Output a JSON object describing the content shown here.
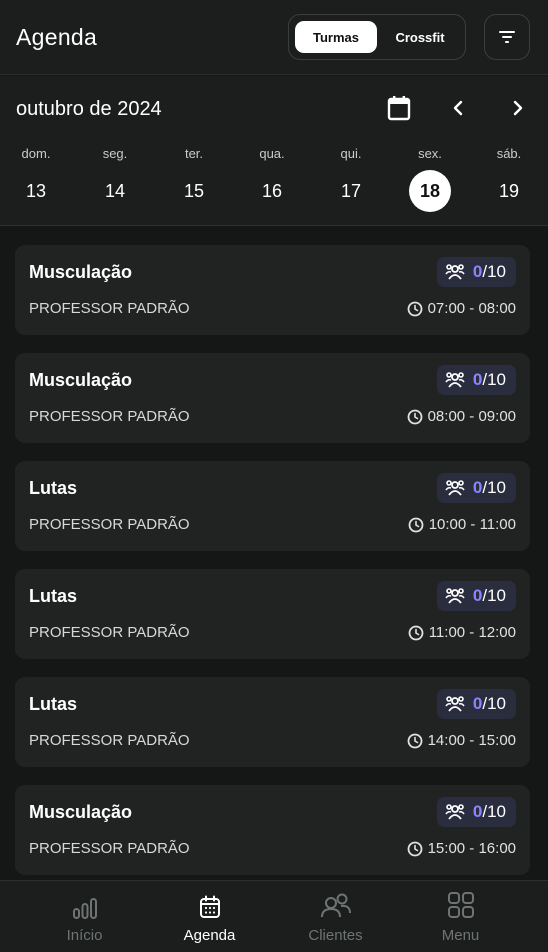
{
  "header": {
    "title": "Agenda",
    "segments": [
      {
        "label": "Turmas",
        "active": true
      },
      {
        "label": "Crossfit",
        "active": false
      }
    ],
    "filter_icon": "filter-icon"
  },
  "calendar": {
    "month_label": "outubro de 2024",
    "icons": {
      "picker": "calendar-icon",
      "prev": "chevron-left-icon",
      "next": "chevron-right-icon"
    },
    "days": [
      {
        "name": "dom.",
        "num": "13",
        "selected": false
      },
      {
        "name": "seg.",
        "num": "14",
        "selected": false
      },
      {
        "name": "ter.",
        "num": "15",
        "selected": false
      },
      {
        "name": "qua.",
        "num": "16",
        "selected": false
      },
      {
        "name": "qui.",
        "num": "17",
        "selected": false
      },
      {
        "name": "sex.",
        "num": "18",
        "selected": true
      },
      {
        "name": "sáb.",
        "num": "19",
        "selected": false
      }
    ]
  },
  "classes": [
    {
      "title": "Musculação",
      "teacher": "PROFESSOR PADRÃO",
      "enrolled": "0",
      "capacity": "/10",
      "time": "07:00 - 08:00"
    },
    {
      "title": "Musculação",
      "teacher": "PROFESSOR PADRÃO",
      "enrolled": "0",
      "capacity": "/10",
      "time": "08:00 - 09:00"
    },
    {
      "title": "Lutas",
      "teacher": "PROFESSOR PADRÃO",
      "enrolled": "0",
      "capacity": "/10",
      "time": "10:00 - 11:00"
    },
    {
      "title": "Lutas",
      "teacher": "PROFESSOR PADRÃO",
      "enrolled": "0",
      "capacity": "/10",
      "time": "11:00 - 12:00"
    },
    {
      "title": "Lutas",
      "teacher": "PROFESSOR PADRÃO",
      "enrolled": "0",
      "capacity": "/10",
      "time": "14:00 - 15:00"
    },
    {
      "title": "Musculação",
      "teacher": "PROFESSOR PADRÃO",
      "enrolled": "0",
      "capacity": "/10",
      "time": "15:00 - 16:00"
    }
  ],
  "nav": {
    "items": [
      {
        "label": "Início",
        "icon": "chart-bars-icon",
        "active": false
      },
      {
        "label": "Agenda",
        "icon": "calendar-icon",
        "active": true
      },
      {
        "label": "Clientes",
        "icon": "users-icon",
        "active": false
      },
      {
        "label": "Menu",
        "icon": "grid-icon",
        "active": false
      }
    ]
  },
  "colors": {
    "background": "#141716",
    "card": "#202322",
    "accent": "#8b85ff",
    "badge": "#2a2d3e"
  }
}
